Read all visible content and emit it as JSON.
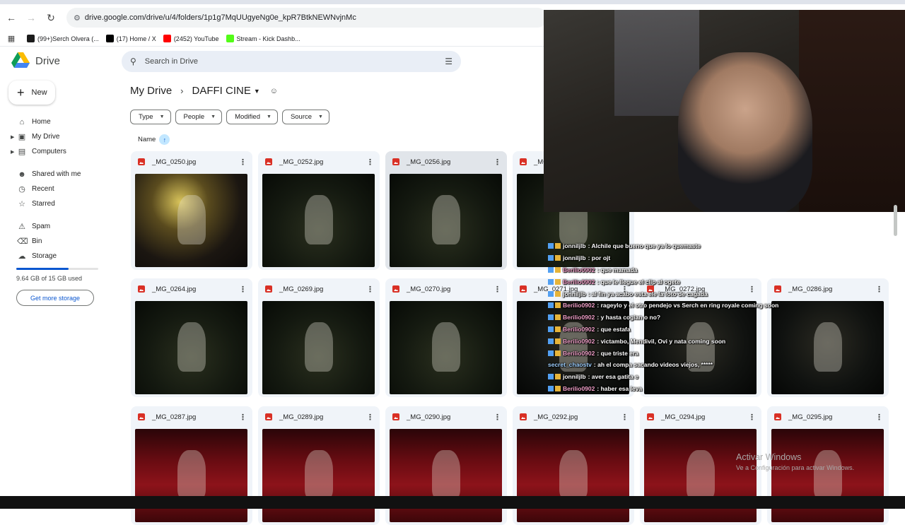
{
  "browser": {
    "url": "drive.google.com/drive/u/4/folders/1p1g7MqUUgyeNg0e_kpR7BtkNEWNvjnMc",
    "bookmarks": [
      {
        "label": "(99+)Serch Olvera (...",
        "color": "#1b1b1b"
      },
      {
        "label": "(17) Home / X",
        "color": "#000000"
      },
      {
        "label": "(2452) YouTube",
        "color": "#ff0000"
      },
      {
        "label": "Stream - Kick Dashb...",
        "color": "#53fc18"
      }
    ]
  },
  "drive": {
    "logo": "Drive",
    "new_label": "New",
    "search_placeholder": "Search in Drive",
    "nav": [
      {
        "label": "Home",
        "icon": "home-icon"
      },
      {
        "label": "My Drive",
        "icon": "drive-icon"
      },
      {
        "label": "Computers",
        "icon": "computer-icon"
      },
      {
        "label": "Shared with me",
        "icon": "people-icon"
      },
      {
        "label": "Recent",
        "icon": "clock-icon"
      },
      {
        "label": "Starred",
        "icon": "star-icon"
      },
      {
        "label": "Spam",
        "icon": "spam-icon"
      },
      {
        "label": "Bin",
        "icon": "trash-icon"
      },
      {
        "label": "Storage",
        "icon": "cloud-icon"
      }
    ],
    "storage": {
      "text": "9.64 GB of 15 GB used",
      "used_fraction": 0.64
    },
    "get_storage": "Get more storage",
    "breadcrumb": {
      "root": "My Drive",
      "current": "DAFFI CINE"
    },
    "filters": [
      "Type",
      "People",
      "Modified",
      "Source"
    ],
    "sort_label": "Name",
    "files": [
      "_MG_0250.jpg",
      "_MG_0252.jpg",
      "_MG_0256.jpg",
      "_MG",
      "_MG_0264.jpg",
      "_MG_0269.jpg",
      "_MG_0270.jpg",
      "_MG_0271.jpg",
      "_MG_0272.jpg",
      "_MG_0286.jpg",
      "_MG_0287.jpg",
      "_MG_0289.jpg",
      "_MG_0290.jpg",
      "_MG_0292.jpg",
      "_MG_0294.jpg",
      "_MG_0295.jpg"
    ]
  },
  "chat": [
    {
      "user": "jonniljlb",
      "msg": ": Alchile que bueno que ya lo quemaste"
    },
    {
      "user": "jonniljlb",
      "msg": ": por ojt"
    },
    {
      "user": "Berilio0902",
      "msg": ": que mamada"
    },
    {
      "user": "Berilio0902",
      "msg": ": que le llegue el clip al ogete"
    },
    {
      "user": "jonniljlb",
      "msg": ": al fin ya acabo esta ele la foto de cagada"
    },
    {
      "user": "Berilio0902",
      "msg": ": rageylo y el otro pendejo vs Serch en ring royale coming soon"
    },
    {
      "user": "Berilio0902",
      "msg": ": y hasta cogian o no?"
    },
    {
      "user": "Berilio0902",
      "msg": ": que estafa"
    },
    {
      "user": "Berilio0902",
      "msg": ": victambo, Mendivil, Ovi y nata coming soon"
    },
    {
      "user": "Berilio0902",
      "msg": ": que triste era"
    },
    {
      "user": "secret_chaostv",
      "msg": ": ah el compa sacando videos viejos, *****"
    },
    {
      "user": "jonniljlb",
      "msg": ": aver esa gatita e"
    },
    {
      "user": "Berilio0902",
      "msg": ": haber esa leva"
    }
  ],
  "watermark": {
    "line1": "Activar Windows",
    "line2": "Ve a Configuración para activar Windows."
  }
}
